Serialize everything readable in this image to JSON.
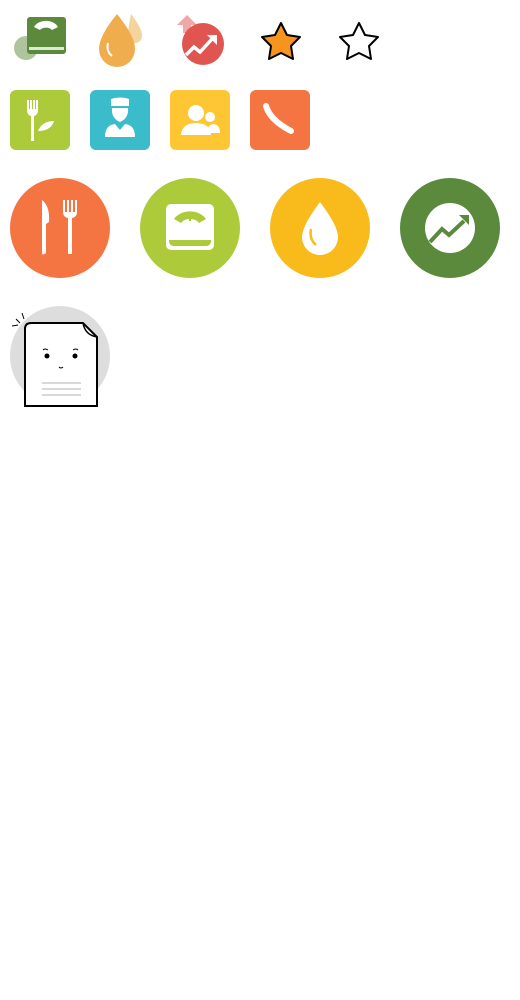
{
  "icons": {
    "row1": [
      "scale-book-icon",
      "water-drops-icon",
      "trend-up-icon",
      "star-filled-icon",
      "star-outline-icon"
    ],
    "row2": [
      "diet-fork-leaf-icon",
      "nurse-icon",
      "contacts-icon",
      "phone-icon"
    ],
    "row3": [
      "meal-icon",
      "weight-scale-icon",
      "water-drop-icon",
      "progress-trend-icon"
    ],
    "row4": [
      "empty-document-icon"
    ]
  },
  "colors": {
    "green": "#5b8a3c",
    "drop_orange": "#f0ad4e",
    "trend_red": "#e05550",
    "star_orange": "#f7941d",
    "lime": "#acca3a",
    "teal": "#3bbccb",
    "yellow": "#fdc632",
    "orange": "#f57542",
    "amber": "#f9bb1c",
    "gray": "#dddddd"
  }
}
